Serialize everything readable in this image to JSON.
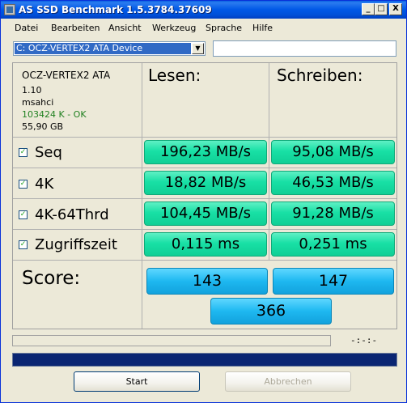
{
  "window": {
    "title": "AS SSD Benchmark 1.5.3784.37609"
  },
  "titlebar": {
    "minimize": "_",
    "maximize": "□",
    "close": "X"
  },
  "menu": [
    "Datei",
    "Bearbeiten",
    "Ansicht",
    "Werkzeug",
    "Sprache",
    "Hilfe"
  ],
  "drive": {
    "selected": "C: OCZ-VERTEX2 ATA Device"
  },
  "info": {
    "model": "OCZ-VERTEX2 ATA",
    "firmware": "1.10",
    "driver": "msahci",
    "alignment": "103424 K - OK",
    "size": "55,90 GB"
  },
  "headers": {
    "read": "Lesen:",
    "write": "Schreiben:"
  },
  "rows": [
    {
      "label": "Seq",
      "checked": true,
      "read": "196,23 MB/s",
      "write": "95,08 MB/s"
    },
    {
      "label": "4K",
      "checked": true,
      "read": "18,82 MB/s",
      "write": "46,53 MB/s"
    },
    {
      "label": "4K-64Thrd",
      "checked": true,
      "read": "104,45 MB/s",
      "write": "91,28 MB/s"
    },
    {
      "label": "Zugriffszeit",
      "checked": true,
      "read": "0,115 ms",
      "write": "0,251 ms"
    }
  ],
  "score": {
    "label": "Score:",
    "read": "143",
    "write": "147",
    "total": "366"
  },
  "status": {
    "elapsed": "-:-:-",
    "progress_pct": 100
  },
  "buttons": {
    "start": "Start",
    "cancel": "Abbrechen"
  },
  "colors": {
    "result_green": "#18e0a5",
    "score_blue": "#1eb8f0",
    "progress": "#0a2572",
    "titlebar": "#0058e6"
  }
}
